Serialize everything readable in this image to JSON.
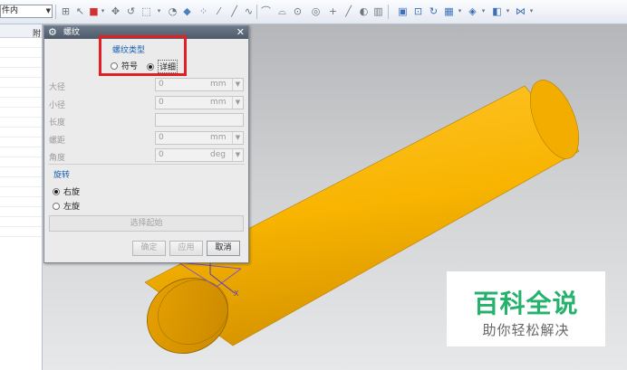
{
  "toolbar": {
    "filter_value": "件内",
    "icons": [
      "snap-icon",
      "select-icon",
      "color-icon",
      "move-icon",
      "rotate-icon",
      "box-icon",
      "view-icon",
      "cube-icon",
      "point-icon",
      "line-icon",
      "curve-icon",
      "arc-icon",
      "circle-icon",
      "plus-icon",
      "measure-icon",
      "layer-icon",
      "screenshot-icon",
      "fit-icon",
      "refresh-icon",
      "display-icon",
      "shade-icon",
      "render-icon",
      "more-icon"
    ]
  },
  "navigator": {
    "column_header": "附"
  },
  "dialog": {
    "title": "螺纹",
    "thread_type": {
      "label": "螺纹类型",
      "options": [
        "符号",
        "详细"
      ],
      "selected": "详细"
    },
    "params": [
      {
        "label": "大径",
        "value": "0",
        "unit": "mm"
      },
      {
        "label": "小径",
        "value": "0",
        "unit": "mm"
      },
      {
        "label": "长度",
        "value": "",
        "unit": ""
      },
      {
        "label": "螺距",
        "value": "0",
        "unit": "mm"
      },
      {
        "label": "角度",
        "value": "0",
        "unit": "deg"
      }
    ],
    "rotation": {
      "label": "旋转",
      "options": [
        "右旋",
        "左旋"
      ],
      "selected": "右旋"
    },
    "select_start_label": "选择起始",
    "buttons": {
      "ok": "确定",
      "apply": "应用",
      "cancel": "取消"
    }
  },
  "viewport": {
    "axis_label": "X",
    "model_color": "#f8b400"
  },
  "watermark": {
    "title": "百科全说",
    "subtitle": "助你轻松解决"
  }
}
